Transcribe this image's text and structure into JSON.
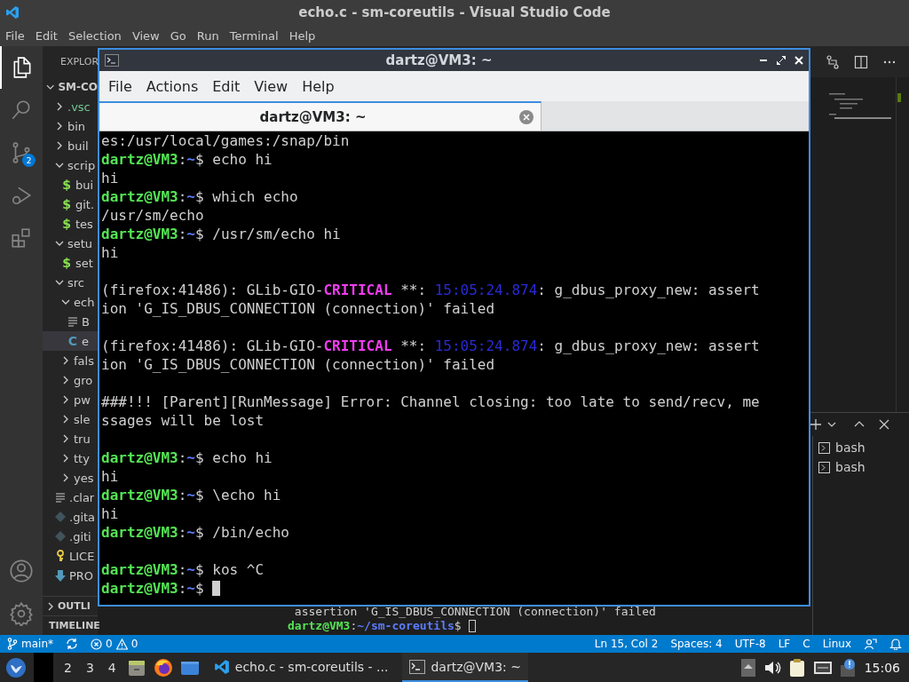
{
  "window": {
    "title": "echo.c - sm-coreutils - Visual Studio Code"
  },
  "menu": [
    "File",
    "Edit",
    "Selection",
    "View",
    "Go",
    "Run",
    "Terminal",
    "Help"
  ],
  "activity_bar": [
    {
      "kind": "files",
      "selected": true
    },
    {
      "kind": "search",
      "selected": false
    },
    {
      "kind": "scm",
      "selected": false,
      "badge": "2"
    },
    {
      "kind": "debug",
      "selected": false
    },
    {
      "kind": "extensions",
      "selected": false
    }
  ],
  "sidebar": {
    "title": "EXPLOR",
    "root": "SM-CO",
    "items": [
      {
        "name": ".vsc",
        "kind": "folder",
        "expanded": false,
        "selected": false,
        "untracked": true
      },
      {
        "name": "bin",
        "kind": "folder",
        "expanded": false,
        "selected": false,
        "untracked": false
      },
      {
        "name": "buil",
        "kind": "folder",
        "expanded": false,
        "selected": false,
        "untracked": false
      },
      {
        "name": "scrip",
        "kind": "folder",
        "expanded": true,
        "selected": false,
        "untracked": false,
        "children": [
          {
            "name": "bui",
            "kind": "shell",
            "icon": "$",
            "selected": false,
            "untracked": false
          },
          {
            "name": "git.",
            "kind": "shell",
            "icon": "$",
            "selected": false,
            "untracked": false
          },
          {
            "name": "tes",
            "kind": "shell",
            "icon": "$",
            "selected": false,
            "untracked": false
          }
        ]
      },
      {
        "name": "setu",
        "kind": "folder",
        "expanded": true,
        "selected": false,
        "untracked": false,
        "children": [
          {
            "name": "set",
            "kind": "shell",
            "icon": "$",
            "selected": false,
            "untracked": false
          }
        ]
      },
      {
        "name": "src",
        "kind": "folder",
        "expanded": true,
        "selected": false,
        "untracked": false,
        "children": [
          {
            "name": "ech",
            "kind": "folder",
            "expanded": true,
            "selected": false,
            "untracked": false,
            "children": [
              {
                "name": "B",
                "kind": "text",
                "selected": false,
                "untracked": false
              },
              {
                "name": "e",
                "kind": "c",
                "icon": "C",
                "selected": true,
                "untracked": false
              }
            ]
          },
          {
            "name": "fals",
            "kind": "folder",
            "expanded": false,
            "selected": false,
            "untracked": false
          },
          {
            "name": "gro",
            "kind": "folder",
            "expanded": false,
            "selected": false,
            "untracked": false
          },
          {
            "name": "pw",
            "kind": "folder",
            "expanded": false,
            "selected": false,
            "untracked": false
          },
          {
            "name": "sle",
            "kind": "folder",
            "expanded": false,
            "selected": false,
            "untracked": false
          },
          {
            "name": "tru",
            "kind": "folder",
            "expanded": false,
            "selected": false,
            "untracked": false
          },
          {
            "name": "tty",
            "kind": "folder",
            "expanded": false,
            "selected": false,
            "untracked": false
          },
          {
            "name": "yes",
            "kind": "folder",
            "expanded": false,
            "selected": false,
            "untracked": false
          }
        ]
      },
      {
        "name": ".clar",
        "kind": "text",
        "selected": false,
        "untracked": false
      },
      {
        "name": ".gita",
        "kind": "git",
        "selected": false,
        "untracked": false
      },
      {
        "name": ".giti",
        "kind": "git",
        "selected": false,
        "untracked": false
      },
      {
        "name": "LICE",
        "kind": "license",
        "selected": false,
        "untracked": false
      },
      {
        "name": "PRO",
        "kind": "download",
        "selected": false,
        "untracked": false
      }
    ],
    "sections": [
      "OUTLI",
      "TIMELINE"
    ]
  },
  "panel": {
    "terminals": [
      "bash",
      "bash"
    ],
    "lines": [
      {
        "segments": [
          {
            "kind": "plain",
            "text": " assertion 'G_IS_DBUS_CONNECTION (connection)' failed"
          }
        ],
        "cursor": false
      },
      {
        "segments": [
          {
            "kind": "user",
            "text": "dartz@VM3"
          },
          {
            "kind": "plain",
            "text": ":"
          },
          {
            "kind": "path",
            "text": "~/sm-coreutils"
          },
          {
            "kind": "plain",
            "text": "$ "
          }
        ],
        "cursor": true
      }
    ]
  },
  "status_bar": {
    "branch": "main*",
    "errors": "0",
    "warnings": "0",
    "items": [
      "Ln 15, Col 2",
      "Spaces: 4",
      "UTF-8",
      "LF",
      "C",
      "Linux"
    ]
  },
  "terminal_window": {
    "title": "dartz@VM3: ~",
    "menu": [
      "File",
      "Actions",
      "Edit",
      "View",
      "Help"
    ],
    "tabs": [
      {
        "label": "dartz@VM3: ~",
        "selected": true
      }
    ],
    "lines": [
      {
        "kind": "text",
        "cursor": false,
        "segments": [
          {
            "kind": "plain",
            "text": "es:/usr/local/games:/snap/bin"
          }
        ]
      },
      {
        "kind": "text",
        "cursor": false,
        "segments": [
          {
            "kind": "user",
            "text": "dartz@VM3"
          },
          {
            "kind": "plain",
            "text": ":"
          },
          {
            "kind": "path",
            "text": "~"
          },
          {
            "kind": "plain",
            "text": "$ echo hi"
          }
        ]
      },
      {
        "kind": "text",
        "cursor": false,
        "segments": [
          {
            "kind": "plain",
            "text": "hi"
          }
        ]
      },
      {
        "kind": "text",
        "cursor": false,
        "segments": [
          {
            "kind": "user",
            "text": "dartz@VM3"
          },
          {
            "kind": "plain",
            "text": ":"
          },
          {
            "kind": "path",
            "text": "~"
          },
          {
            "kind": "plain",
            "text": "$ which echo"
          }
        ]
      },
      {
        "kind": "text",
        "cursor": false,
        "segments": [
          {
            "kind": "plain",
            "text": "/usr/sm/echo"
          }
        ]
      },
      {
        "kind": "text",
        "cursor": false,
        "segments": [
          {
            "kind": "user",
            "text": "dartz@VM3"
          },
          {
            "kind": "plain",
            "text": ":"
          },
          {
            "kind": "path",
            "text": "~"
          },
          {
            "kind": "plain",
            "text": "$ /usr/sm/echo hi"
          }
        ]
      },
      {
        "kind": "text",
        "cursor": false,
        "segments": [
          {
            "kind": "plain",
            "text": "hi"
          }
        ]
      },
      {
        "kind": "blank",
        "cursor": false
      },
      {
        "kind": "text",
        "cursor": false,
        "segments": [
          {
            "kind": "plain",
            "text": "(firefox:41486): GLib-GIO-"
          },
          {
            "kind": "critical",
            "text": "CRITICAL"
          },
          {
            "kind": "plain",
            "text": " **: "
          },
          {
            "kind": "time",
            "text": "15:05:24.874"
          },
          {
            "kind": "plain",
            "text": ": g_dbus_proxy_new: assert"
          }
        ]
      },
      {
        "kind": "text",
        "cursor": false,
        "segments": [
          {
            "kind": "plain",
            "text": "ion 'G_IS_DBUS_CONNECTION (connection)' failed"
          }
        ]
      },
      {
        "kind": "blank",
        "cursor": false
      },
      {
        "kind": "text",
        "cursor": false,
        "segments": [
          {
            "kind": "plain",
            "text": "(firefox:41486): GLib-GIO-"
          },
          {
            "kind": "critical",
            "text": "CRITICAL"
          },
          {
            "kind": "plain",
            "text": " **: "
          },
          {
            "kind": "time",
            "text": "15:05:24.874"
          },
          {
            "kind": "plain",
            "text": ": g_dbus_proxy_new: assert"
          }
        ]
      },
      {
        "kind": "text",
        "cursor": false,
        "segments": [
          {
            "kind": "plain",
            "text": "ion 'G_IS_DBUS_CONNECTION (connection)' failed"
          }
        ]
      },
      {
        "kind": "blank",
        "cursor": false
      },
      {
        "kind": "text",
        "cursor": false,
        "segments": [
          {
            "kind": "plain",
            "text": "###!!! [Parent][RunMessage] Error: Channel closing: too late to send/recv, me"
          }
        ]
      },
      {
        "kind": "text",
        "cursor": false,
        "segments": [
          {
            "kind": "plain",
            "text": "ssages will be lost"
          }
        ]
      },
      {
        "kind": "blank",
        "cursor": false
      },
      {
        "kind": "text",
        "cursor": false,
        "segments": [
          {
            "kind": "user",
            "text": "dartz@VM3"
          },
          {
            "kind": "plain",
            "text": ":"
          },
          {
            "kind": "path",
            "text": "~"
          },
          {
            "kind": "plain",
            "text": "$ echo hi"
          }
        ]
      },
      {
        "kind": "text",
        "cursor": false,
        "segments": [
          {
            "kind": "plain",
            "text": "hi"
          }
        ]
      },
      {
        "kind": "text",
        "cursor": false,
        "segments": [
          {
            "kind": "user",
            "text": "dartz@VM3"
          },
          {
            "kind": "plain",
            "text": ":"
          },
          {
            "kind": "path",
            "text": "~"
          },
          {
            "kind": "plain",
            "text": "$ \\echo hi"
          }
        ]
      },
      {
        "kind": "text",
        "cursor": false,
        "segments": [
          {
            "kind": "plain",
            "text": "hi"
          }
        ]
      },
      {
        "kind": "text",
        "cursor": false,
        "segments": [
          {
            "kind": "user",
            "text": "dartz@VM3"
          },
          {
            "kind": "plain",
            "text": ":"
          },
          {
            "kind": "path",
            "text": "~"
          },
          {
            "kind": "plain",
            "text": "$ /bin/echo"
          }
        ]
      },
      {
        "kind": "blank",
        "cursor": false
      },
      {
        "kind": "text",
        "cursor": false,
        "segments": [
          {
            "kind": "user",
            "text": "dartz@VM3"
          },
          {
            "kind": "plain",
            "text": ":"
          },
          {
            "kind": "path",
            "text": "~"
          },
          {
            "kind": "plain",
            "text": "$ kos ^C"
          }
        ]
      },
      {
        "kind": "text",
        "cursor": true,
        "segments": [
          {
            "kind": "user",
            "text": "dartz@VM3"
          },
          {
            "kind": "plain",
            "text": ":"
          },
          {
            "kind": "path",
            "text": "~"
          },
          {
            "kind": "plain",
            "text": "$ "
          }
        ]
      }
    ]
  },
  "taskbar": {
    "workspaces": [
      {
        "label": "2",
        "selected": false
      },
      {
        "label": "3",
        "selected": false
      },
      {
        "label": "4",
        "selected": false
      }
    ],
    "launchers": [
      {
        "kind": "files"
      },
      {
        "kind": "firefox"
      },
      {
        "kind": "folder"
      }
    ],
    "tasks": [
      {
        "label": "echo.c - sm-coreutils - ...",
        "kind": "vscode",
        "selected": false
      },
      {
        "label": "dartz@VM3: ~",
        "kind": "terminal",
        "selected": true
      }
    ],
    "clock": "15:06"
  }
}
